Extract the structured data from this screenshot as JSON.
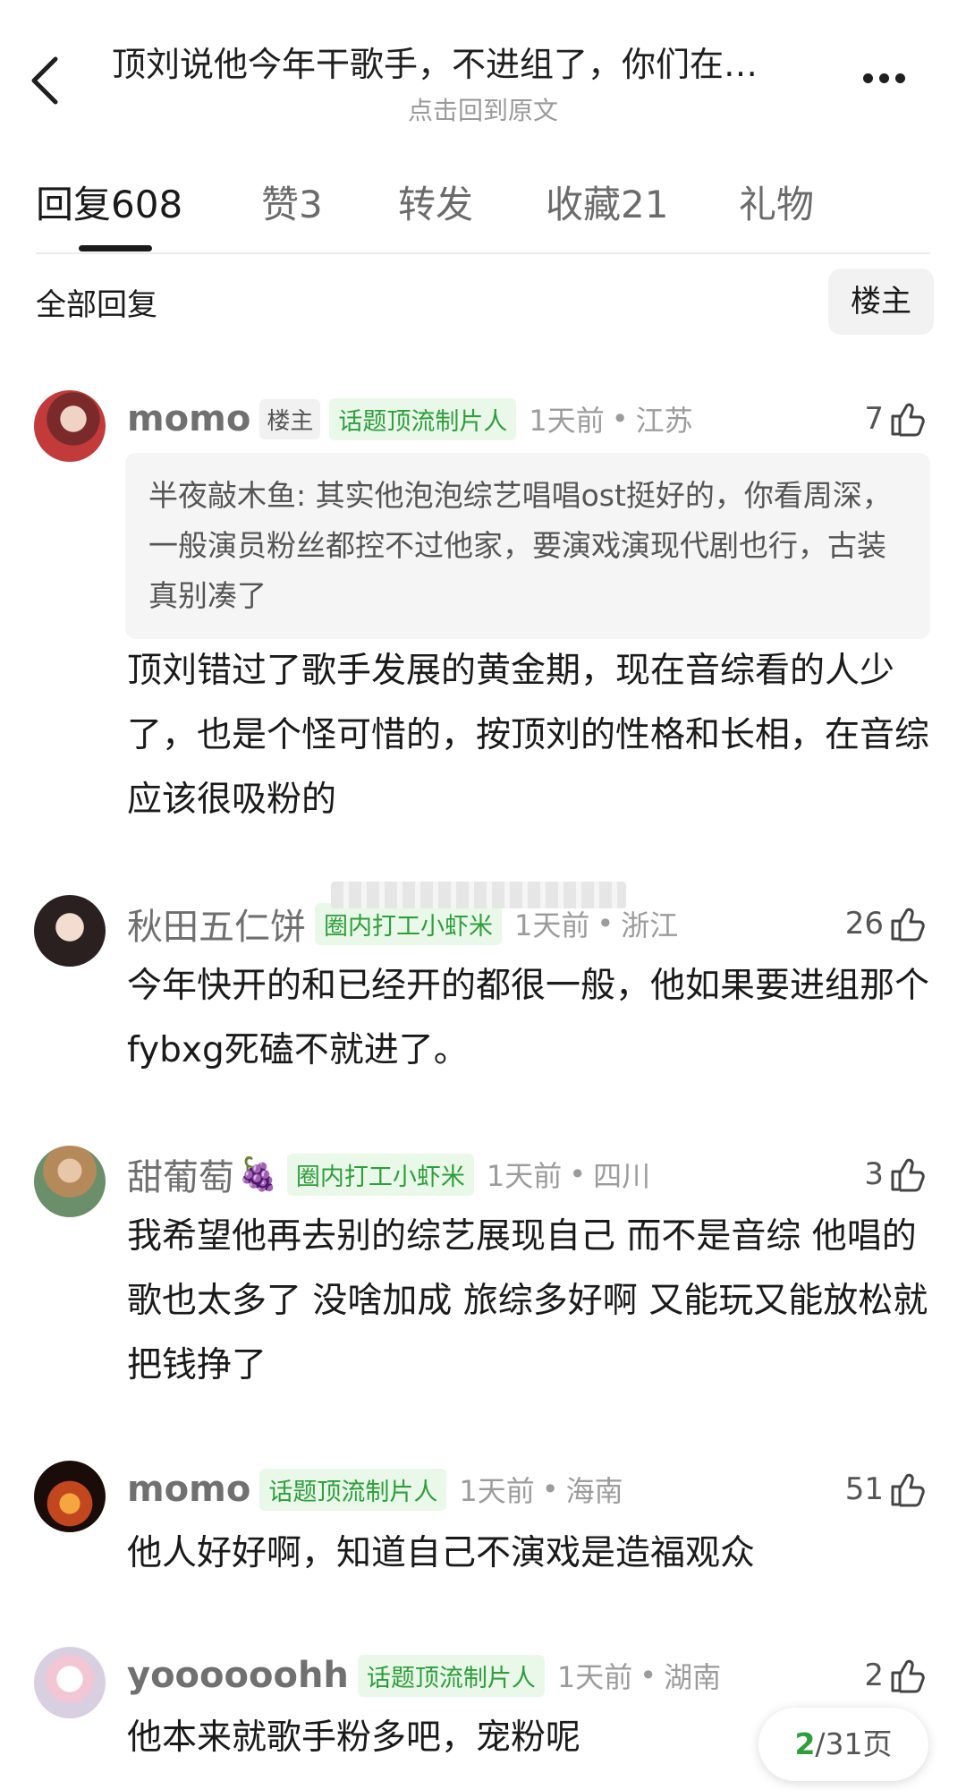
{
  "header": {
    "title": "顶刘说他今年干歌手，不进组了，你们在…",
    "subtitle": "点击回到原文",
    "back_icon": "chevron-left-icon",
    "more_icon": "more-dots-icon"
  },
  "tabs": [
    {
      "label": "回复",
      "count": "608",
      "active": true
    },
    {
      "label": "赞",
      "count": "3",
      "active": false
    },
    {
      "label": "转发",
      "count": "",
      "active": false
    },
    {
      "label": "收藏",
      "count": "21",
      "active": false
    },
    {
      "label": "礼物",
      "count": "",
      "active": false
    }
  ],
  "filter": {
    "label": "全部回复",
    "op_button": "楼主"
  },
  "comments": [
    {
      "username": "momo",
      "op_badge": "楼主",
      "title_badge": "话题顶流制片人",
      "time": "1天前",
      "location": "江苏",
      "likes": "7",
      "quote": "半夜敲木鱼: 其实他泡泡综艺唱唱ost挺好的，你看周深，一般演员粉丝都控不过他家，要演戏演现代剧也行，古装真别凑了",
      "text": "顶刘错过了歌手发展的黄金期，现在音综看的人少了，也是个怪可惜的，按顶刘的性格和长相，在音综应该很吸粉的"
    },
    {
      "username": "秋田五仁饼",
      "title_badge": "圈内打工小虾米",
      "time": "1天前",
      "location": "浙江",
      "likes": "26",
      "text": "今年快开的和已经开的都很一般，他如果要进组那个fybxg死磕不就进了。"
    },
    {
      "username": "甜葡萄",
      "emoji": "🍇",
      "title_badge": "圈内打工小虾米",
      "time": "1天前",
      "location": "四川",
      "likes": "3",
      "text": "我希望他再去别的综艺展现自己 而不是音综 他唱的歌也太多了 没啥加成 旅综多好啊 又能玩又能放松就把钱挣了"
    },
    {
      "username": "momo",
      "title_badge": "话题顶流制片人",
      "time": "1天前",
      "location": "海南",
      "likes": "51",
      "text": "他人好好啊，知道自己不演戏是造福观众"
    },
    {
      "username": "yoooooohh",
      "title_badge": "话题顶流制片人",
      "time": "1天前",
      "location": "湖南",
      "likes": "2",
      "text": "他本来就歌手粉多吧，宠粉呢"
    }
  ],
  "pager": {
    "current": "2",
    "total": "/31页"
  },
  "colors": {
    "accent_green": "#2f9e3c",
    "badge_green_bg": "#eaf8ea",
    "quote_bg": "#f5f5f5"
  }
}
